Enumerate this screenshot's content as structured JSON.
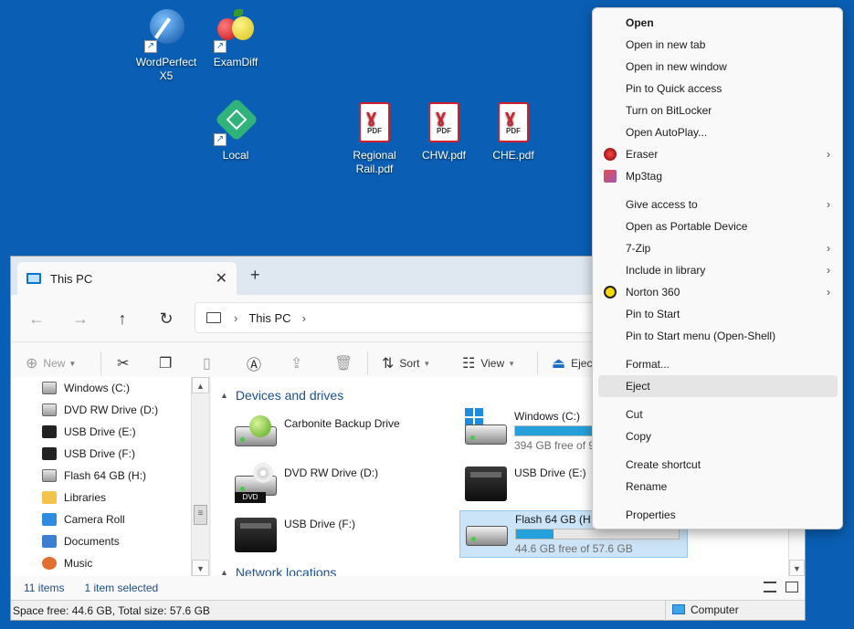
{
  "desktop": {
    "icons": [
      {
        "label": "WordPerfect X5"
      },
      {
        "label": "ExamDiff"
      },
      {
        "label": "Local"
      },
      {
        "label": "Regional Rail.pdf"
      },
      {
        "label": "CHW.pdf"
      },
      {
        "label": "CHE.pdf"
      }
    ],
    "pdf_badge": "PDF"
  },
  "explorer": {
    "tab_title": "This PC",
    "tab_close": "✕",
    "new_tab": "+",
    "address": {
      "crumb": "This PC"
    },
    "commands": {
      "new": "New",
      "sort": "Sort",
      "view": "View",
      "eject": "Ejec"
    },
    "nav": [
      {
        "label": "Windows (C:)"
      },
      {
        "label": "DVD RW Drive (D:)"
      },
      {
        "label": "USB Drive (E:)"
      },
      {
        "label": "USB Drive (F:)"
      },
      {
        "label": "Flash 64 GB (H:)"
      },
      {
        "label": "Libraries"
      },
      {
        "label": "Camera Roll"
      },
      {
        "label": "Documents"
      },
      {
        "label": "Music"
      }
    ],
    "groups": {
      "devices": "Devices and drives",
      "network": "Network locations"
    },
    "drives": {
      "carbonite": {
        "name": "Carbonite Backup Drive"
      },
      "windows": {
        "name": "Windows (C:)",
        "free": "394 GB free of 95",
        "used_fraction": 0.6
      },
      "dvd": {
        "name": "DVD RW Drive (D:)",
        "badge": "DVD"
      },
      "usb_e": {
        "name": "USB Drive (E:)"
      },
      "usb_f": {
        "name": "USB Drive (F:)"
      },
      "flash": {
        "name": "Flash 64 GB (H:)",
        "free": "44.6 GB free of 57.6 GB",
        "used_fraction": 0.23
      }
    },
    "status": {
      "items": "11 items",
      "selected": "1 item selected",
      "space": "Space free: 44.6 GB, Total size: 57.6 GB",
      "location": "Computer"
    }
  },
  "context_menu": {
    "items": [
      {
        "label": "Open"
      },
      {
        "label": "Open in new tab"
      },
      {
        "label": "Open in new window"
      },
      {
        "label": "Pin to Quick access"
      },
      {
        "label": "Turn on BitLocker"
      },
      {
        "label": "Open AutoPlay..."
      },
      {
        "label": "Eraser"
      },
      {
        "label": "Mp3tag"
      },
      {
        "label": "Give access to"
      },
      {
        "label": "Open as Portable Device"
      },
      {
        "label": "7-Zip"
      },
      {
        "label": "Include in library"
      },
      {
        "label": "Norton 360"
      },
      {
        "label": "Pin to Start"
      },
      {
        "label": "Pin to Start menu (Open-Shell)"
      },
      {
        "label": "Format..."
      },
      {
        "label": "Eject"
      },
      {
        "label": "Cut"
      },
      {
        "label": "Copy"
      },
      {
        "label": "Create shortcut"
      },
      {
        "label": "Rename"
      },
      {
        "label": "Properties"
      }
    ],
    "submenu_glyph": "›"
  },
  "colors": {
    "desktop_bg": "#0a5fb4",
    "accent": "#26a0da",
    "pdf_red": "#d0202a"
  }
}
